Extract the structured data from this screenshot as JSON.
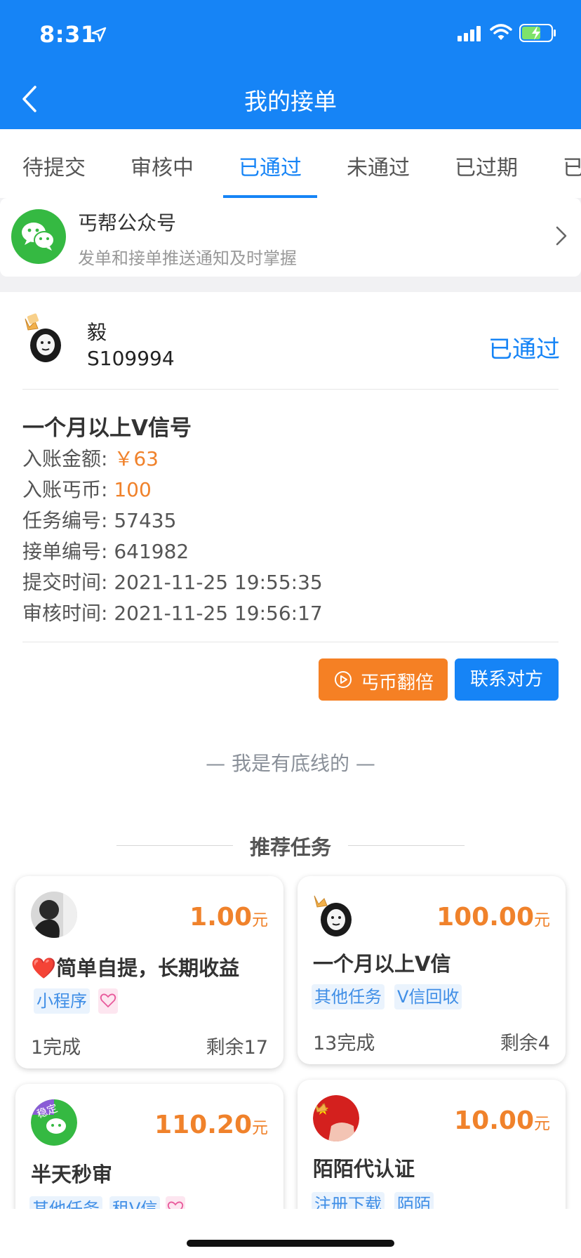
{
  "status_bar": {
    "time": "8:31"
  },
  "header": {
    "title": "我的接单"
  },
  "tabs": [
    {
      "label": "待提交"
    },
    {
      "label": "审核中"
    },
    {
      "label": "已通过"
    },
    {
      "label": "未通过"
    },
    {
      "label": "已过期"
    },
    {
      "label": "已"
    }
  ],
  "wechat_banner": {
    "title": "丐帮公众号",
    "subtitle": "发单和接单推送通知及时掌握"
  },
  "order": {
    "user_name": "毅",
    "user_id": "S109994",
    "status": "已通过",
    "title": "一个月以上V信号",
    "lines": [
      {
        "label": "入账金额: ",
        "value": "￥63"
      },
      {
        "label": "入账丐币: ",
        "value": "100"
      },
      {
        "label": "任务编号: ",
        "value": "57435"
      },
      {
        "label": "接单编号: ",
        "value": "641982"
      },
      {
        "label": "提交时间: ",
        "value": "2021-11-25 19:55:35"
      },
      {
        "label": "审核时间: ",
        "value": "2021-11-25 19:56:17"
      }
    ],
    "double_button": "丐币翻倍",
    "contact_button": "联系对方"
  },
  "bottom_line": "— 我是有底线的 —",
  "recommend": {
    "title": "推荐任务",
    "currency": "元",
    "tasks": [
      {
        "price": "1.00",
        "name": "❤️简单自提，长期收益",
        "tags": [
          "小程序"
        ],
        "done": "1完成",
        "remain": "剩余17"
      },
      {
        "price": "100.00",
        "name": "一个月以上V信",
        "tags": [
          "其他任务",
          "V信回收"
        ],
        "done": "13完成",
        "remain": "剩余4"
      },
      {
        "price": "110.20",
        "name": "半天秒审",
        "tags": [
          "其他任务",
          "租V信"
        ],
        "avatar_text": "稳定"
      },
      {
        "price": "10.00",
        "name": "陌陌代认证",
        "tags": [
          "注册下载",
          "陌陌"
        ]
      }
    ]
  },
  "colors": {
    "primary": "#1684f6",
    "accent": "#f0822b",
    "wechat": "#35b942"
  }
}
